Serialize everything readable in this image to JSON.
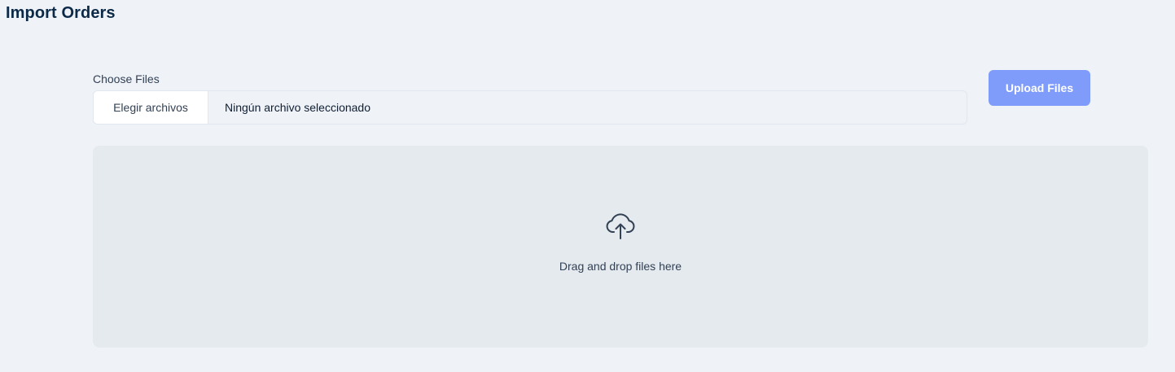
{
  "page": {
    "title": "Import Orders"
  },
  "file_picker": {
    "label": "Choose Files",
    "button_label": "Elegir archivos",
    "status": "Ningún archivo seleccionado"
  },
  "upload": {
    "button_label": "Upload Files"
  },
  "dropzone": {
    "icon": "cloud-upload-icon",
    "text": "Drag and drop files here"
  },
  "colors": {
    "background": "#eff3f7",
    "title": "#0c2a47",
    "upload_button": "#7f9cfb",
    "dropzone": "#e5eaef"
  }
}
